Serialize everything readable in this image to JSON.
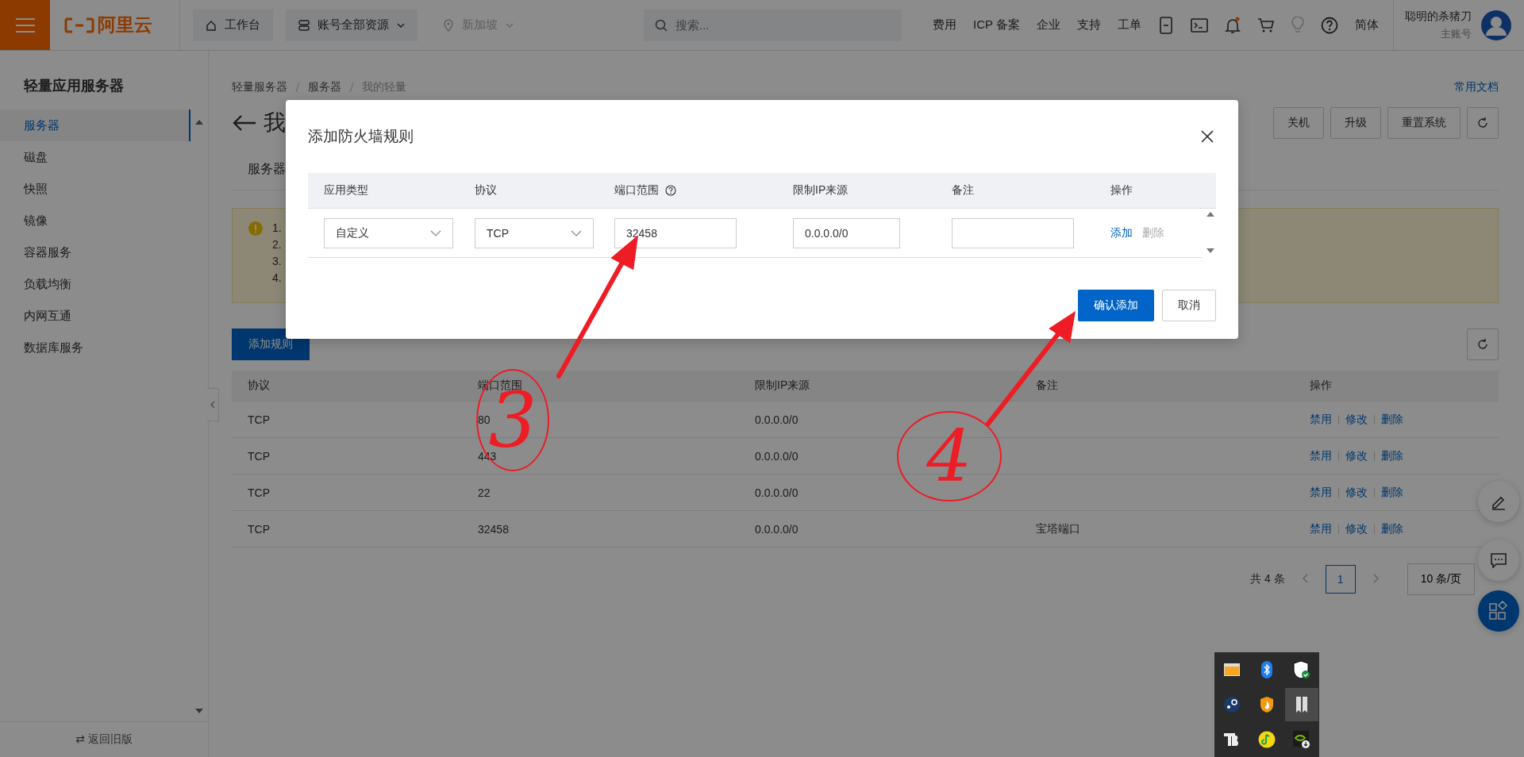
{
  "topbar": {
    "logo": "阿里云",
    "nav": [
      {
        "label": "工作台",
        "kind": "home",
        "disabled": false
      },
      {
        "label": "账号全部资源",
        "kind": "resources",
        "disabled": false
      },
      {
        "label": "新加坡",
        "kind": "region",
        "disabled": true
      }
    ],
    "search": {
      "placeholder": "搜索..."
    },
    "links": [
      "费用",
      "ICP 备案",
      "企业",
      "支持",
      "工单"
    ],
    "language": "简体",
    "user": {
      "name": "聪明的杀猪刀",
      "role": "主账号"
    }
  },
  "sidebar": {
    "title": "轻量应用服务器",
    "items": [
      {
        "label": "服务器",
        "selected": true
      },
      {
        "label": "磁盘",
        "selected": false
      },
      {
        "label": "快照",
        "selected": false
      },
      {
        "label": "镜像",
        "selected": false
      },
      {
        "label": "容器服务",
        "selected": false
      },
      {
        "label": "负载均衡",
        "selected": false
      },
      {
        "label": "内网互通",
        "selected": false
      },
      {
        "label": "数据库服务",
        "selected": false
      }
    ],
    "footer": "⇄ 返回旧版"
  },
  "breadcrumb": [
    "轻量服务器",
    "服务器",
    "我的轻量"
  ],
  "page": {
    "title": "我",
    "help_link": "常用文档",
    "actions": [
      "关机",
      "升级",
      "重置系统"
    ],
    "tab": "服务器",
    "notice": [
      "1.",
      "2.",
      "3.",
      "4."
    ],
    "add_button": "添加规则"
  },
  "rules_table": {
    "columns": [
      "协议",
      "端口范围",
      "限制IP来源",
      "备注",
      "操作"
    ],
    "rows": [
      {
        "protocol": "TCP",
        "port": "80",
        "ip": "0.0.0.0/0",
        "actions": [
          "禁用",
          "修改",
          "删除"
        ]
      },
      {
        "protocol": "TCP",
        "port": "443",
        "ip": "0.0.0.0/0",
        "actions": [
          "禁用",
          "修改",
          "删除"
        ]
      },
      {
        "protocol": "TCP",
        "port": "22",
        "ip": "0.0.0.0/0",
        "actions": [
          "禁用",
          "修改",
          "删除"
        ]
      },
      {
        "protocol": "TCP",
        "port": "32458",
        "ip": "0.0.0.0/0",
        "note": "宝塔端口",
        "actions": [
          "禁用",
          "修改",
          "删除"
        ]
      }
    ]
  },
  "pagination": {
    "total": "共 4 条",
    "page": "1",
    "page_size": "10 条/页"
  },
  "dialog": {
    "title": "添加防火墙规则",
    "columns": [
      "应用类型",
      "协议",
      "端口范围",
      "限制IP来源",
      "备注",
      "操作"
    ],
    "row": {
      "app_type": "自定义",
      "protocol": "TCP",
      "port": "32458",
      "ip": "0.0.0.0/0"
    },
    "row_actions": [
      {
        "label": "添加",
        "disabled": false
      },
      {
        "label": "删除",
        "disabled": true
      }
    ],
    "buttons": [
      {
        "label": "确认添加",
        "kind": "primary"
      },
      {
        "label": "取消",
        "kind": "default"
      }
    ]
  },
  "annotations": [
    {
      "label": "3"
    },
    {
      "label": "4"
    }
  ]
}
